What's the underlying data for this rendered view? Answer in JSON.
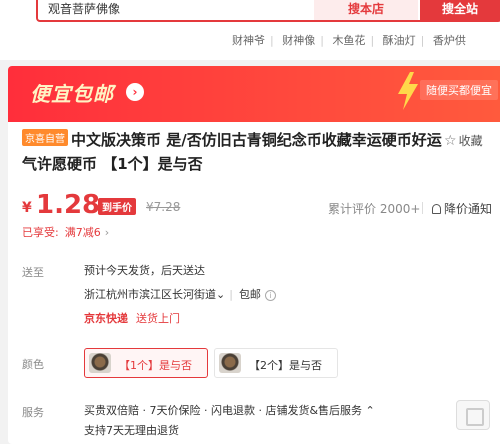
{
  "search": {
    "query": "观音菩萨佛像",
    "store_button": "搜本店",
    "all_button": "搜全站",
    "hotwords": [
      "财神爷",
      "财神像",
      "木鱼花",
      "酥油灯",
      "香炉供"
    ]
  },
  "banner": {
    "title": "便宜包邮",
    "slogan": "随便买都便宜"
  },
  "product": {
    "self_tag": "京喜自营",
    "title": "中文版决策币 是/否仿旧古青铜纪念币收藏幸运硬币好运气许愿硬币 【1个】是与否",
    "favorite_label": "收藏"
  },
  "price": {
    "currency": "¥",
    "value": "1.28",
    "tag": "到手价",
    "original": "¥7.28",
    "reviews": "累计评价 2000+",
    "alert": "降价通知"
  },
  "discount": {
    "label": "已享受:",
    "value": "满7减6"
  },
  "shipping": {
    "label": "送至",
    "eta": "预计今天发货，后天送达",
    "address": "浙江杭州市滨江区长河街道",
    "free_shipping": "包邮",
    "carrier": "京东快递",
    "door": "送货上门"
  },
  "color": {
    "label": "颜色",
    "options": [
      "【1个】是与否",
      "【2个】是与否"
    ],
    "selected_index": 0
  },
  "service": {
    "label": "服务",
    "items": "买贵双倍赔 · 7天价保险 · 闪电退款 · 店铺发货&售后服务",
    "sub": "支持7天无理由退货"
  },
  "colors": {
    "accent": "#e4393c",
    "banner": "#ff2e3b",
    "self_tag": "#ff8a2c"
  }
}
